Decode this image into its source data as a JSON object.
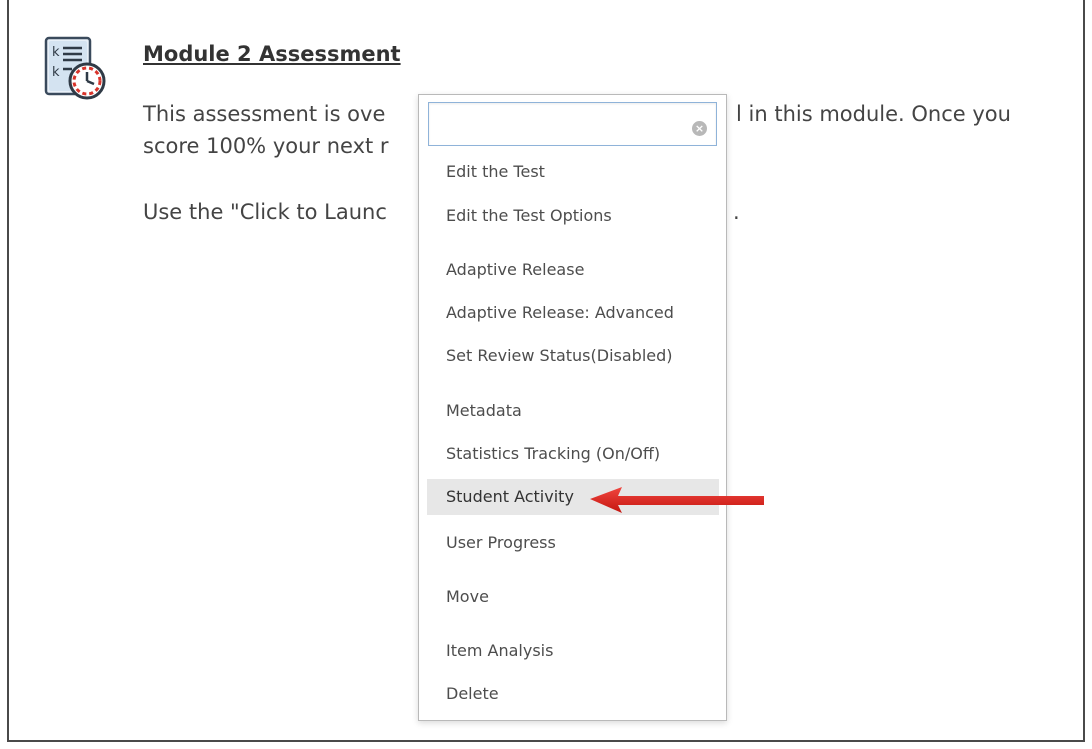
{
  "content": {
    "title": "Module 2 Assessment",
    "para1_line1_left": "This assessment is ove",
    "para1_line1_right": "l in this module. Once you",
    "para1_line2_left": "score 100% your next r",
    "para2_left": "Use the \"Click to Launc",
    "para2_right": "."
  },
  "menu": {
    "search": {
      "value": "",
      "placeholder": ""
    },
    "items": [
      {
        "label": "Edit the Test"
      },
      {
        "label": "Edit the Test Options"
      },
      {
        "label": "Adaptive Release"
      },
      {
        "label": "Adaptive Release: Advanced"
      },
      {
        "label": "Set Review Status(Disabled)"
      },
      {
        "label": "Metadata"
      },
      {
        "label": "Statistics Tracking (On/Off)"
      },
      {
        "label": "Student Activity"
      },
      {
        "label": "User Progress"
      },
      {
        "label": "Move"
      },
      {
        "label": "Item Analysis"
      },
      {
        "label": "Delete"
      }
    ],
    "highlighted_item": "Student Activity"
  },
  "icons": {
    "test": "test-clock-icon",
    "clear": "clear-icon",
    "annotation": "red-arrow-icon"
  },
  "colors": {
    "highlight_bg": "#e7e7e7",
    "arrow": "#e0201b",
    "search_border": "#8fb3d9"
  }
}
